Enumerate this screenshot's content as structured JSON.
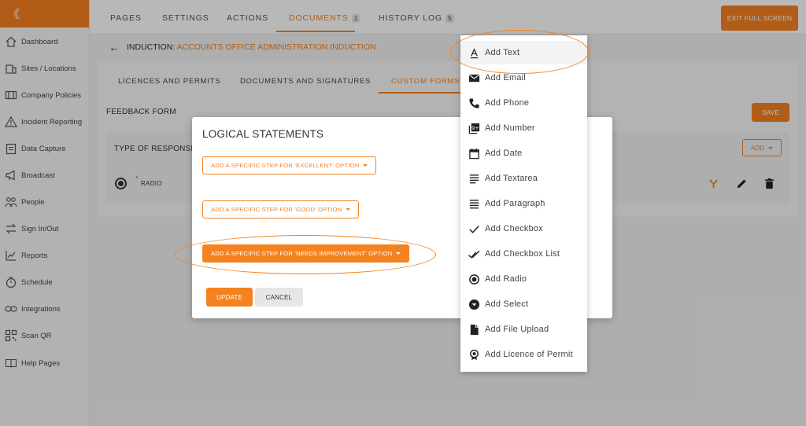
{
  "sidebar": {
    "collapse_glyph": "《",
    "items": [
      {
        "label": "Dashboard",
        "icon": "home-icon"
      },
      {
        "label": "Sites / Locations",
        "icon": "building-icon"
      },
      {
        "label": "Company Policies",
        "icon": "book-icon"
      },
      {
        "label": "Incident Reporting",
        "icon": "warning-icon"
      },
      {
        "label": "Data Capture",
        "icon": "clipboard-icon"
      },
      {
        "label": "Broadcast",
        "icon": "megaphone-icon"
      },
      {
        "label": "People",
        "icon": "people-icon"
      },
      {
        "label": "Sign In/Out",
        "icon": "swap-icon"
      },
      {
        "label": "Reports",
        "icon": "chart-icon"
      },
      {
        "label": "Schedule",
        "icon": "stopwatch-icon"
      },
      {
        "label": "Integrations",
        "icon": "link-icon"
      },
      {
        "label": "Scan QR",
        "icon": "qr-icon"
      },
      {
        "label": "Help Pages",
        "icon": "book-open-icon"
      }
    ]
  },
  "topnav": {
    "tabs": [
      {
        "label": "PAGES"
      },
      {
        "label": "SETTINGS"
      },
      {
        "label": "ACTIONS"
      },
      {
        "label": "DOCUMENTS",
        "badge": "1",
        "active": true
      },
      {
        "label": "HISTORY LOG",
        "badge": "5"
      }
    ],
    "exit_label": "EXIT FULL SCREEN"
  },
  "induction": {
    "prefix": "INDUCTION: ",
    "name": "ACCOUNTS OFFICE ADMINISTRATION INDUCTION"
  },
  "subtabs": [
    {
      "label": "LICENCES AND PERMITS"
    },
    {
      "label": "DOCUMENTS AND SIGNATURES"
    },
    {
      "label": "CUSTOM FORMS",
      "active": true
    }
  ],
  "form": {
    "title": "FEEDBACK FORM",
    "save_label": "SAVE",
    "response_label": "TYPE OF RESPONSE",
    "add_label": "ADD",
    "required_mark": "*",
    "field_label": "RADIO"
  },
  "modal": {
    "title": "LOGICAL STATEMENTS",
    "options": [
      {
        "label": "ADD A SPECIFIC STEP FOR 'EXCELLENT' OPTION"
      },
      {
        "label": "ADD A SPECIFIC STEP FOR 'GOOD' OPTION"
      },
      {
        "label": "ADD A SPECIFIC STEP FOR 'NEEDS IMPROVEMENT' OPTION",
        "highlighted": true
      }
    ],
    "update_label": "UPDATE",
    "cancel_label": "CANCEL"
  },
  "menu": {
    "items": [
      {
        "label": "Add Text",
        "icon": "text-icon",
        "highlighted": true
      },
      {
        "label": "Add Email",
        "icon": "email-icon"
      },
      {
        "label": "Add Phone",
        "icon": "phone-icon"
      },
      {
        "label": "Add Number",
        "icon": "number-icon"
      },
      {
        "label": "Add Date",
        "icon": "calendar-icon"
      },
      {
        "label": "Add Textarea",
        "icon": "textarea-icon"
      },
      {
        "label": "Add Paragraph",
        "icon": "paragraph-icon"
      },
      {
        "label": "Add Checkbox",
        "icon": "check-icon"
      },
      {
        "label": "Add Checkbox List",
        "icon": "double-check-icon"
      },
      {
        "label": "Add Radio",
        "icon": "radio-icon"
      },
      {
        "label": "Add Select",
        "icon": "select-icon"
      },
      {
        "label": "Add File Upload",
        "icon": "file-icon"
      },
      {
        "label": "Add Licence of Permit",
        "icon": "badge-icon"
      }
    ]
  },
  "colors": {
    "accent": "#f58220",
    "annotation": "#f58220"
  }
}
